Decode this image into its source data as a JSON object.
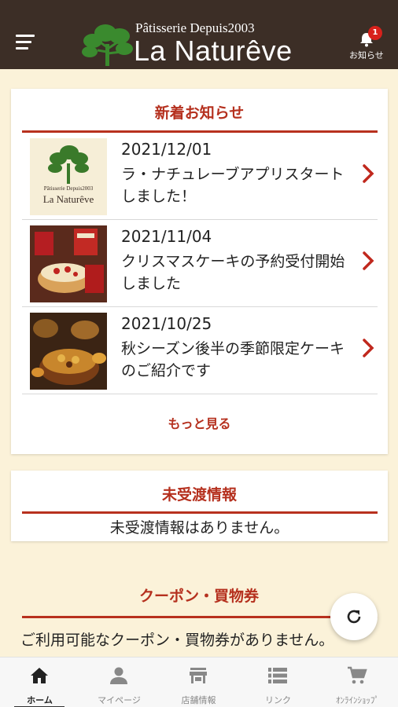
{
  "header": {
    "logo_sub": "Pâtisserie Depuis2003",
    "logo_main": "La Naturêve",
    "notifications_label": "お知らせ",
    "notifications_count": "1"
  },
  "news": {
    "title": "新着お知らせ",
    "items": [
      {
        "date": "2021/12/01",
        "title": "ラ・ナチュレーブアプリスタートしました！"
      },
      {
        "date": "2021/11/04",
        "title": "クリスマスケーキの予約受付開始しました"
      },
      {
        "date": "2021/10/25",
        "title": "秋シーズン後半の季節限定ケーキのご紹介です"
      }
    ],
    "more_label": "もっと見る",
    "thumb1_logo_sub": "Pâtisserie Depuis2003",
    "thumb1_logo_main": "La Naturêve"
  },
  "undelivered": {
    "title": "未受渡情報",
    "empty_text": "未受渡情報はありません。"
  },
  "coupons": {
    "title": "クーポン・買物券",
    "empty_text": "ご利用可能なクーポン・買物券がありません。"
  },
  "bottom_nav": {
    "items": [
      {
        "label": "ホーム",
        "icon": "home-icon",
        "active": true
      },
      {
        "label": "マイページ",
        "icon": "person-icon",
        "active": false
      },
      {
        "label": "店舗情報",
        "icon": "store-icon",
        "active": false
      },
      {
        "label": "リンク",
        "icon": "list-icon",
        "active": false
      },
      {
        "label": "ｵﾝﾗｲﾝｼｮｯﾌﾟ",
        "icon": "cart-icon",
        "active": false
      }
    ]
  },
  "colors": {
    "header_bg": "#3c2e26",
    "page_bg": "#fbf2d9",
    "accent_red": "#b5301e",
    "badge_red": "#d8211b",
    "logo_green": "#3a8a2e"
  }
}
